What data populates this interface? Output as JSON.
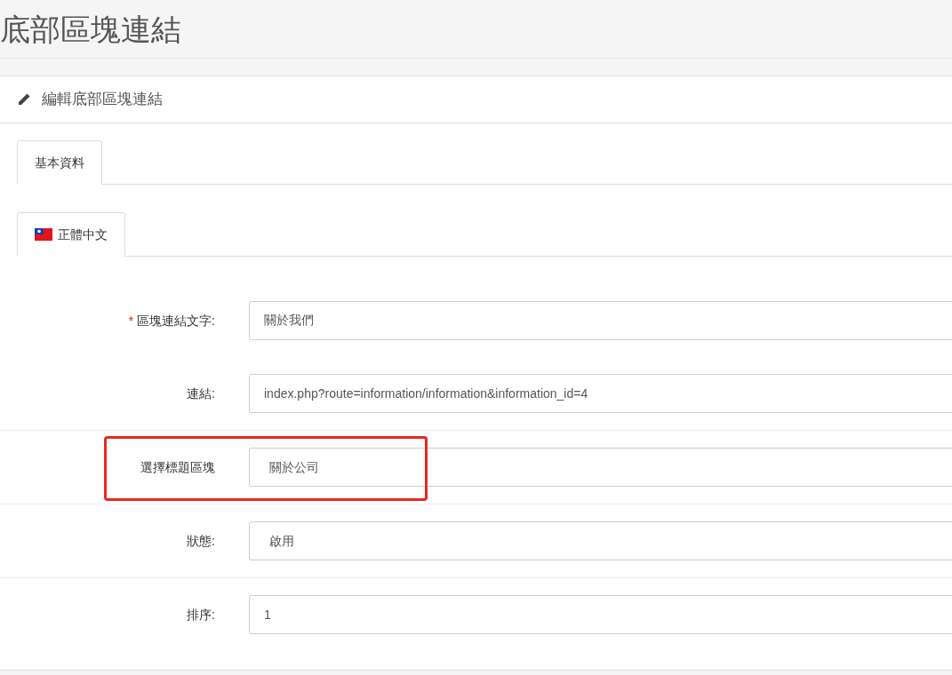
{
  "page_title": "底部區塊連結",
  "panel_title": "編輯底部區塊連結",
  "tabs": [
    {
      "label": "基本資料",
      "selected": true
    }
  ],
  "language_tabs": [
    {
      "label": "正體中文",
      "selected": true
    }
  ],
  "fields": [
    {
      "required_mark": "*",
      "label": "區塊連結文字:",
      "kind": "text",
      "value": "關於我們",
      "highlighted": false
    },
    {
      "label": "連結:",
      "kind": "text",
      "value": "index.php?route=information/information&information_id=4",
      "highlighted": false
    },
    {
      "label": "選擇標題區塊",
      "kind": "select",
      "value": "關於公司",
      "highlighted": true
    },
    {
      "label": "狀態:",
      "kind": "select",
      "value": "啟用",
      "highlighted": false
    },
    {
      "label": "排序:",
      "kind": "text",
      "value": "1",
      "highlighted": false
    }
  ]
}
